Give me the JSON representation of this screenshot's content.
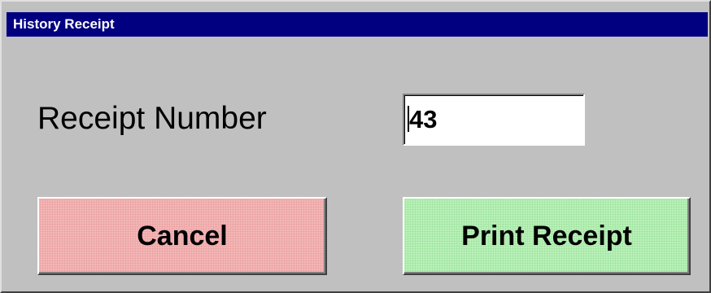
{
  "window": {
    "title": "History Receipt"
  },
  "form": {
    "receipt_label": "Receipt Number",
    "receipt_value": "43"
  },
  "buttons": {
    "cancel_label": "Cancel",
    "print_label": "Print Receipt"
  },
  "colors": {
    "titlebar": "#000080",
    "dialog_bg": "#c0c0c0",
    "cancel_bg": "#f4b6b6",
    "print_bg": "#b9f2b9"
  }
}
